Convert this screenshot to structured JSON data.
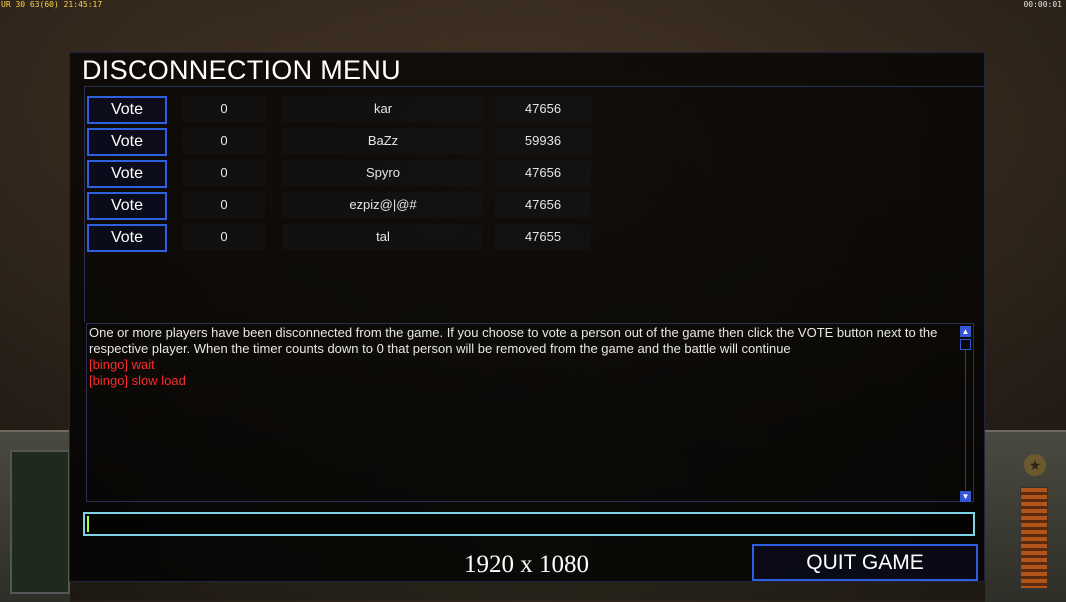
{
  "overlay": {
    "top_left_stats": "UR 30 63(60) 21:45:17",
    "top_right_timer": "00:00:01"
  },
  "panel": {
    "title": "DISCONNECTION MENU",
    "vote_label": "Vote",
    "players": [
      {
        "count": "0",
        "name": "kar",
        "id": "47656"
      },
      {
        "count": "0",
        "name": "BaZz",
        "id": "59936"
      },
      {
        "count": "0",
        "name": "Spyro",
        "id": "47656"
      },
      {
        "count": "0",
        "name": "ezpiz@|@#",
        "id": "47656"
      },
      {
        "count": "0",
        "name": "tal",
        "id": "47655"
      }
    ],
    "messages": {
      "info": "One or more players have been disconnected from the game. If you choose to vote a person out of the game then click the VOTE button next to the respective player. When the timer counts down to 0 that person will be removed from the game and the battle will continue",
      "chat": [
        "[bingo] wait",
        "[bingo] slow load"
      ]
    },
    "chat_input_value": "",
    "resolution_label": "1920 x 1080",
    "quit_label": "QUIT GAME"
  },
  "colors": {
    "accent_blue": "#2f5fe0",
    "chat_red": "#ff2a2a",
    "input_border": "#7ed3e6"
  }
}
